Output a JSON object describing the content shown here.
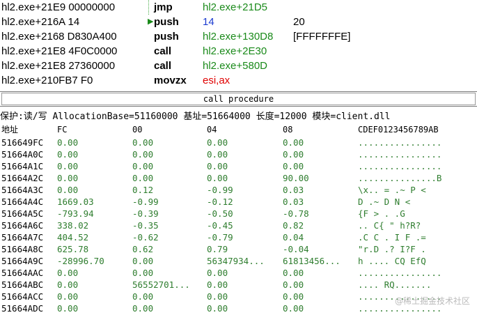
{
  "disassembly": [
    {
      "address": "hl2.exe+21E9 00000000",
      "mnemonic": "jmp",
      "operand": "hl2.exe+21D5",
      "operand_color": "#1a8a1a",
      "comment": ""
    },
    {
      "address": "hl2.exe+216A 14",
      "mnemonic": "push",
      "operand": "14",
      "operand_color": "#1a3ad0",
      "comment": "20"
    },
    {
      "address": "hl2.exe+2168 D830A400",
      "mnemonic": "push",
      "operand": "hl2.exe+130D8",
      "operand_color": "#1a8a1a",
      "comment": "[FFFFFFFE]"
    },
    {
      "address": "hl2.exe+21E8 4F0C0000",
      "mnemonic": "call",
      "operand": "hl2.exe+2E30",
      "operand_color": "#1a8a1a",
      "comment": ""
    },
    {
      "address": "hl2.exe+21E8 27360000",
      "mnemonic": "call",
      "operand": "hl2.exe+580D",
      "operand_color": "#1a8a1a",
      "comment": ""
    },
    {
      "address": "hl2.exe+210FB7 F0",
      "mnemonic": "movzx",
      "operand": "esi,ax",
      "operand_color": "#e00000",
      "comment": ""
    }
  ],
  "call_button_label": "call procedure",
  "memory_header": "保护:读/写  AllocationBase=51160000 基址=51664000 长度=12000 模块=client.dll",
  "columns": {
    "addr": "地址",
    "c0": "FC",
    "c1": "00",
    "c2": "04",
    "c3": "08",
    "ascii": "CDEF0123456789AB"
  },
  "memory_rows": [
    {
      "addr": "516649FC",
      "v": [
        "0.00",
        "0.00",
        "0.00",
        "0.00"
      ],
      "ascii": "................"
    },
    {
      "addr": "51664A0C",
      "v": [
        "0.00",
        "0.00",
        "0.00",
        "0.00"
      ],
      "ascii": "................"
    },
    {
      "addr": "51664A1C",
      "v": [
        "0.00",
        "0.00",
        "0.00",
        "0.00"
      ],
      "ascii": "................"
    },
    {
      "addr": "51664A2C",
      "v": [
        "0.00",
        "0.00",
        "0.00",
        "90.00"
      ],
      "ascii": "...............B"
    },
    {
      "addr": "51664A3C",
      "v": [
        "0.00",
        "0.12",
        "-0.99",
        "0.03"
      ],
      "ascii": "\\x..   = .~ P  <"
    },
    {
      "addr": "51664A4C",
      "v": [
        "1669.03",
        "-0.99",
        "-0.12",
        "0.03"
      ],
      "ascii": "   D .~  D  N  <"
    },
    {
      "addr": "51664A5C",
      "v": [
        "-793.94",
        "-0.39",
        "-0.50",
        "-0.78"
      ],
      "ascii": " {F  >  .   .G"
    },
    {
      "addr": "51664A6C",
      "v": [
        "338.02",
        "-0.35",
        "-0.45",
        "0.82"
      ],
      "ascii": ".. C{    \"  h?R?"
    },
    {
      "addr": "51664A7C",
      "v": [
        "404.52",
        "-0.62",
        "-0.79",
        "0.04"
      ],
      "ascii": ".C C   .  I F .="
    },
    {
      "addr": "51664A8C",
      "v": [
        "625.78",
        "0.62",
        "0.79",
        "-0.04"
      ],
      "ascii": "\"r.D  .?  I?F ."
    },
    {
      "addr": "51664A9C",
      "v": [
        "-28996.70",
        "0.00",
        "56347934...",
        "61813456..."
      ],
      "ascii": "h   ....   CQ EfQ"
    },
    {
      "addr": "51664AAC",
      "v": [
        "0.00",
        "0.00",
        "0.00",
        "0.00"
      ],
      "ascii": "................"
    },
    {
      "addr": "51664ABC",
      "v": [
        "0.00",
        "56552701...",
        "0.00",
        "0.00"
      ],
      "ascii": "....   RQ......."
    },
    {
      "addr": "51664ACC",
      "v": [
        "0.00",
        "0.00",
        "0.00",
        "0.00"
      ],
      "ascii": "................"
    },
    {
      "addr": "51664ADC",
      "v": [
        "0.00",
        "0.00",
        "0.00",
        "0.00"
      ],
      "ascii": "................"
    }
  ],
  "watermark": "@稀土掘金技术社区"
}
